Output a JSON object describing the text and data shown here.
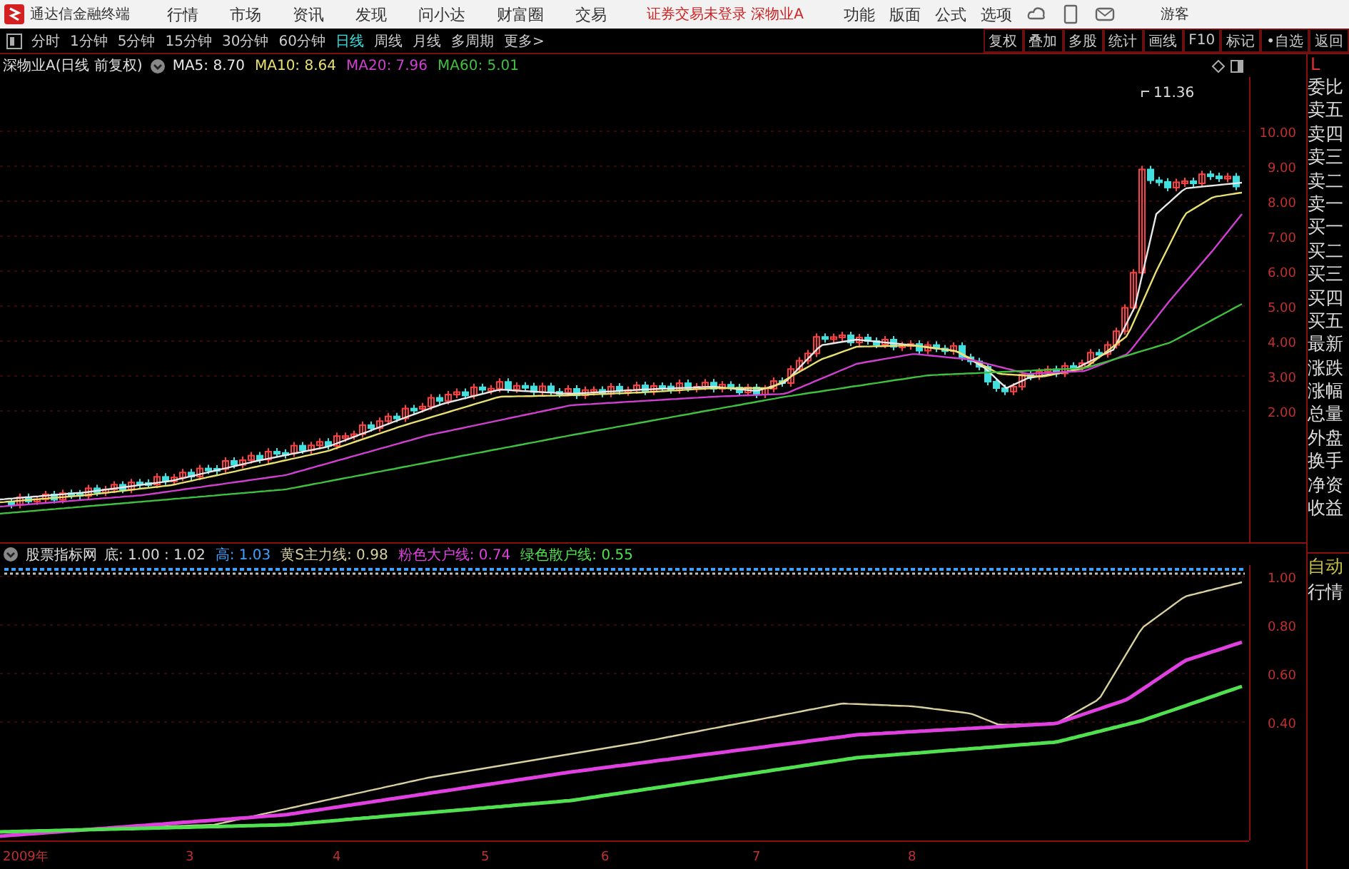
{
  "window": {
    "title": "通达信金融终端",
    "menu": [
      "行情",
      "市场",
      "资讯",
      "发现",
      "问小达",
      "财富圈",
      "交易"
    ],
    "notice": "证券交易未登录 深物业A",
    "menu_right": [
      "功能",
      "版面",
      "公式",
      "选项"
    ],
    "user": "游客"
  },
  "period_tabs": [
    {
      "label": "分时",
      "selected": false
    },
    {
      "label": "1分钟",
      "selected": false
    },
    {
      "label": "5分钟",
      "selected": false
    },
    {
      "label": "15分钟",
      "selected": false
    },
    {
      "label": "30分钟",
      "selected": false
    },
    {
      "label": "60分钟",
      "selected": false
    },
    {
      "label": "日线",
      "selected": true
    },
    {
      "label": "周线",
      "selected": false
    },
    {
      "label": "月线",
      "selected": false
    },
    {
      "label": "多周期",
      "selected": false
    },
    {
      "label": "更多>",
      "selected": false
    }
  ],
  "tool_buttons": [
    "复权",
    "叠加",
    "多股",
    "统计",
    "画线",
    "F10",
    "标记",
    "•自选",
    "返回"
  ],
  "price_chart": {
    "title": "深物业A(日线 前复权)",
    "legend": [
      {
        "label": "MA5: 8.70",
        "color": "#e8e8e8"
      },
      {
        "label": "MA10: 8.64",
        "color": "#e8e070"
      },
      {
        "label": "MA20: 7.96",
        "color": "#d040d0"
      },
      {
        "label": "MA60: 5.01",
        "color": "#40c040"
      }
    ],
    "high_label": "11.36",
    "axis_ticks": [
      "10.00",
      "9.00",
      "8.00",
      "7.00",
      "6.00",
      "5.00",
      "4.00",
      "3.00",
      "2.00"
    ]
  },
  "indicator": {
    "title": "股票指标网",
    "legend": [
      {
        "label": "底: 1.00 : 1.02",
        "color": "#d8d8d8"
      },
      {
        "label": "高: 1.03",
        "color": "#40a0ff"
      },
      {
        "label": "黄S主力线: 0.98",
        "color": "#d8d0a0"
      },
      {
        "label": "粉色大户线: 0.74",
        "color": "#e040e0"
      },
      {
        "label": "绿色散户线: 0.55",
        "color": "#50e050"
      }
    ],
    "axis_ticks": [
      "1.00",
      "0.80",
      "0.60",
      "0.40"
    ]
  },
  "time_axis": [
    "2009年",
    "3",
    "4",
    "5",
    "6",
    "7",
    "8"
  ],
  "side_panel": {
    "header": "L",
    "quote_fields": [
      "委比",
      "卖五",
      "卖四",
      "卖三",
      "卖二",
      "卖一",
      "买一",
      "买二",
      "买三",
      "买四",
      "买五",
      "最新",
      "涨跌",
      "涨幅",
      "总量",
      "外盘",
      "换手",
      "净资",
      "收益"
    ],
    "modes": [
      "自动",
      "行情"
    ]
  }
}
